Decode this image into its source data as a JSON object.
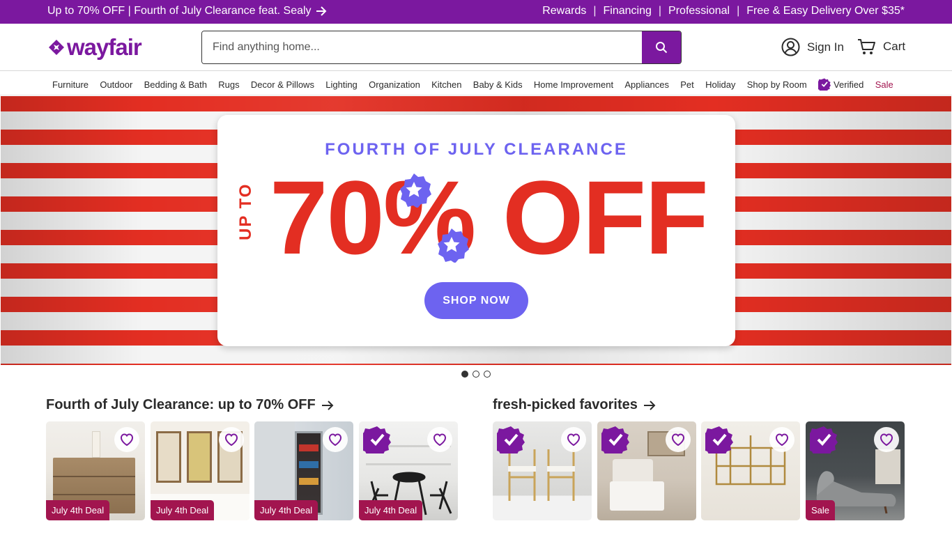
{
  "promo": {
    "left_text": "Up to 70% OFF | Fourth of July Clearance feat. Sealy",
    "links": [
      "Rewards",
      "Financing",
      "Professional",
      "Free & Easy Delivery Over $35*"
    ]
  },
  "header": {
    "logo_text": "wayfair",
    "search_placeholder": "Find anything home...",
    "sign_in_label": "Sign In",
    "cart_label": "Cart"
  },
  "nav": {
    "items": [
      "Furniture",
      "Outdoor",
      "Bedding & Bath",
      "Rugs",
      "Decor & Pillows",
      "Lighting",
      "Organization",
      "Kitchen",
      "Baby & Kids",
      "Home Improvement",
      "Appliances",
      "Pet",
      "Holiday",
      "Shop by Room"
    ],
    "verified_label": "Verified",
    "sale_label": "Sale"
  },
  "hero": {
    "kicker": "FOURTH OF JULY CLEARANCE",
    "up_to": "UP TO",
    "headline": "70% OFF",
    "button": "SHOP NOW",
    "slide_count": 3,
    "active_slide": 1
  },
  "sections": [
    {
      "title": "Fourth of July Clearance: up to 70% OFF",
      "tiles": [
        {
          "badge": "July 4th Deal",
          "verified": false
        },
        {
          "badge": "July 4th Deal",
          "verified": false
        },
        {
          "badge": "July 4th Deal",
          "verified": false
        },
        {
          "badge": "July 4th Deal",
          "verified": true
        }
      ]
    },
    {
      "title": "fresh-picked favorites",
      "tiles": [
        {
          "badge": "",
          "verified": true
        },
        {
          "badge": "",
          "verified": true
        },
        {
          "badge": "",
          "verified": true
        },
        {
          "badge": "Sale",
          "verified": true
        }
      ]
    }
  ],
  "colors": {
    "brand": "#7b189f",
    "sale": "#a2154f",
    "hero_red": "#e32e22",
    "hero_blue": "#6d63f0"
  }
}
